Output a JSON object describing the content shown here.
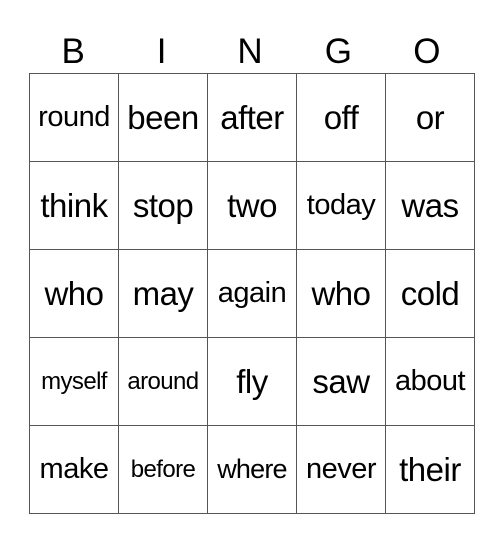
{
  "title_letters": [
    "B",
    "I",
    "N",
    "G",
    "O"
  ],
  "rows": [
    [
      "round",
      "been",
      "after",
      "off",
      "or"
    ],
    [
      "think",
      "stop",
      "two",
      "today",
      "was"
    ],
    [
      "who",
      "may",
      "again",
      "who",
      "cold"
    ],
    [
      "myself",
      "around",
      "fly",
      "saw",
      "about"
    ],
    [
      "make",
      "before",
      "where",
      "never",
      "their"
    ]
  ]
}
